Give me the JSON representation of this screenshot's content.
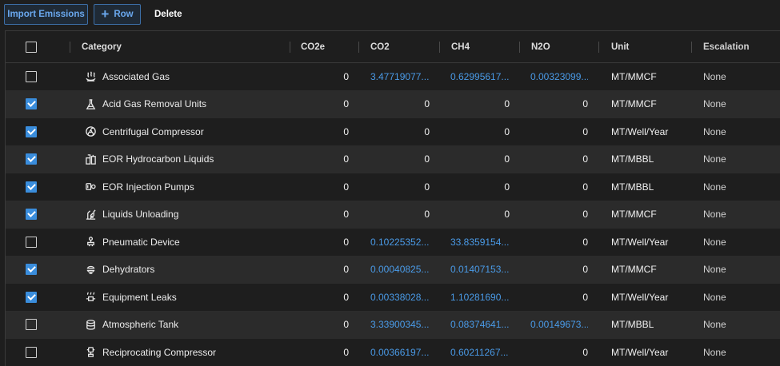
{
  "toolbar": {
    "import_label": "Import Emissions",
    "row_label": "Row",
    "delete_label": "Delete"
  },
  "columns": {
    "category": "Category",
    "co2e": "CO2e",
    "co2": "CO2",
    "ch4": "CH4",
    "n2o": "N2O",
    "unit": "Unit",
    "escalation": "Escalation"
  },
  "colors": {
    "accent": "#3a8ddc",
    "link": "#4a9be8"
  },
  "rows": [
    {
      "checked": false,
      "icon": "gas-flame-icon",
      "category": "Associated Gas",
      "co2e": "0",
      "co2": "3.47719077...",
      "ch4": "0.62995617...",
      "n2o": "0.00323099...",
      "unit": "MT/MMCF",
      "escalation": "None"
    },
    {
      "checked": true,
      "icon": "flask-icon",
      "category": "Acid Gas Removal Units",
      "co2e": "0",
      "co2": "0",
      "ch4": "0",
      "n2o": "0",
      "unit": "MT/MMCF",
      "escalation": "None"
    },
    {
      "checked": true,
      "icon": "fan-icon",
      "category": "Centrifugal Compressor",
      "co2e": "0",
      "co2": "0",
      "ch4": "0",
      "n2o": "0",
      "unit": "MT/Well/Year",
      "escalation": "None"
    },
    {
      "checked": true,
      "icon": "tanks-icon",
      "category": "EOR Hydrocarbon Liquids",
      "co2e": "0",
      "co2": "0",
      "ch4": "0",
      "n2o": "0",
      "unit": "MT/MBBL",
      "escalation": "None"
    },
    {
      "checked": true,
      "icon": "pump-icon",
      "category": "EOR Injection Pumps",
      "co2e": "0",
      "co2": "0",
      "ch4": "0",
      "n2o": "0",
      "unit": "MT/MBBL",
      "escalation": "None"
    },
    {
      "checked": true,
      "icon": "unloading-icon",
      "category": "Liquids Unloading",
      "co2e": "0",
      "co2": "0",
      "ch4": "0",
      "n2o": "0",
      "unit": "MT/MMCF",
      "escalation": "None"
    },
    {
      "checked": false,
      "icon": "valve-icon",
      "category": "Pneumatic Device",
      "co2e": "0",
      "co2": "0.10225352...",
      "ch4": "33.8359154...",
      "n2o": "0",
      "unit": "MT/Well/Year",
      "escalation": "None"
    },
    {
      "checked": true,
      "icon": "dehydrator-icon",
      "category": "Dehydrators",
      "co2e": "0",
      "co2": "0.00040825...",
      "ch4": "0.01407153...",
      "n2o": "0",
      "unit": "MT/MMCF",
      "escalation": "None"
    },
    {
      "checked": true,
      "icon": "leak-icon",
      "category": "Equipment Leaks",
      "co2e": "0",
      "co2": "0.00338028...",
      "ch4": "1.10281690...",
      "n2o": "0",
      "unit": "MT/Well/Year",
      "escalation": "None"
    },
    {
      "checked": false,
      "icon": "tank-icon",
      "category": "Atmospheric Tank",
      "co2e": "0",
      "co2": "3.33900345...",
      "ch4": "0.08374641...",
      "n2o": "0.00149673...",
      "unit": "MT/MBBL",
      "escalation": "None"
    },
    {
      "checked": false,
      "icon": "compressor-icon",
      "category": "Reciprocating Compressor",
      "co2e": "0",
      "co2": "0.00366197...",
      "ch4": "0.60211267...",
      "n2o": "0",
      "unit": "MT/Well/Year",
      "escalation": "None"
    }
  ]
}
